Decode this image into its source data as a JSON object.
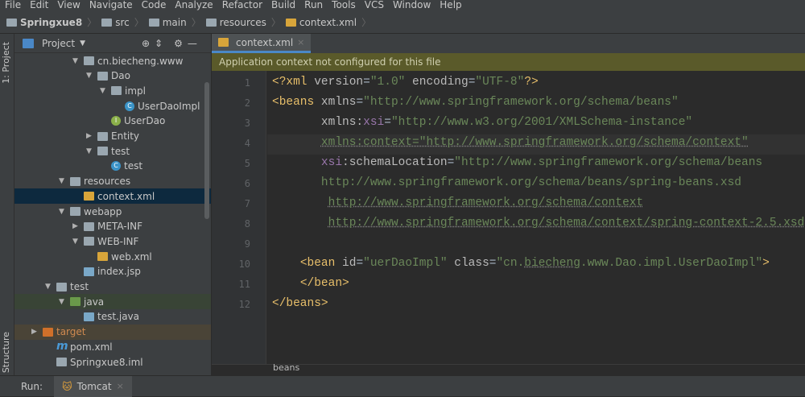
{
  "menu": [
    "File",
    "Edit",
    "View",
    "Navigate",
    "Code",
    "Analyze",
    "Refactor",
    "Build",
    "Run",
    "Tools",
    "VCS",
    "Window",
    "Help"
  ],
  "breadcrumb": [
    "Springxue8",
    "src",
    "main",
    "resources",
    "context.xml"
  ],
  "side_tabs": {
    "project": "1: Project",
    "structure": "Structure"
  },
  "panel": {
    "title": "Project"
  },
  "tree": [
    {
      "label": "cn.biecheng.www",
      "icon": "package",
      "arrow": "▼",
      "level": 4
    },
    {
      "label": "Dao",
      "icon": "folder",
      "arrow": "▼",
      "level": 5
    },
    {
      "label": "impl",
      "icon": "folder",
      "arrow": "▼",
      "level": 6
    },
    {
      "label": "UserDaoImpl",
      "icon": "class",
      "arrow": "",
      "level": 7
    },
    {
      "label": "UserDao",
      "icon": "interface",
      "arrow": "",
      "level": 6
    },
    {
      "label": "Entity",
      "icon": "folder",
      "arrow": "▶",
      "level": 5
    },
    {
      "label": "test",
      "icon": "folder",
      "arrow": "▼",
      "level": 5
    },
    {
      "label": "test",
      "icon": "class",
      "arrow": "",
      "level": 6
    },
    {
      "label": "resources",
      "icon": "folder",
      "arrow": "▼",
      "level": 3
    },
    {
      "label": "context.xml",
      "icon": "xml",
      "arrow": "",
      "level": 4,
      "selected": true
    },
    {
      "label": "webapp",
      "icon": "folder",
      "arrow": "▼",
      "level": 3
    },
    {
      "label": "META-INF",
      "icon": "folder",
      "arrow": "▶",
      "level": 4
    },
    {
      "label": "WEB-INF",
      "icon": "folder",
      "arrow": "▼",
      "level": 4
    },
    {
      "label": "web.xml",
      "icon": "xml",
      "arrow": "",
      "level": 5
    },
    {
      "label": "index.jsp",
      "icon": "jsp",
      "arrow": "",
      "level": 4
    },
    {
      "label": "test",
      "icon": "folder",
      "arrow": "▼",
      "level": 2
    },
    {
      "label": "java",
      "icon": "folder-green",
      "arrow": "▼",
      "level": 3,
      "highlight": "green"
    },
    {
      "label": "test.java",
      "icon": "jsp",
      "arrow": "",
      "level": 4
    },
    {
      "label": "target",
      "icon": "folder-orange",
      "arrow": "▶",
      "level": 1,
      "highlight": "brown"
    },
    {
      "label": "pom.xml",
      "icon": "maven",
      "arrow": "",
      "level": 2
    },
    {
      "label": "Springxue8.iml",
      "icon": "iml",
      "arrow": "",
      "level": 2
    }
  ],
  "editor": {
    "tab": "context.xml",
    "notice": "Application context not configured for this file",
    "lines": [
      [
        [
          "tag",
          "<?xml "
        ],
        [
          "att",
          "version"
        ],
        [
          "",
          "="
        ],
        [
          "str",
          "\"1.0\""
        ],
        [
          "att",
          " encoding"
        ],
        [
          "",
          "="
        ],
        [
          "str",
          "\"UTF-8\""
        ],
        [
          "tag",
          "?>"
        ]
      ],
      [
        [
          "tag",
          "<beans "
        ],
        [
          "att",
          "xmlns"
        ],
        [
          "",
          "="
        ],
        [
          "str",
          "\"http://www.springframework.org/schema/beans\""
        ]
      ],
      [
        [
          "",
          "       "
        ],
        [
          "att",
          "xmlns:"
        ],
        [
          "ns",
          "xsi"
        ],
        [
          "",
          "="
        ],
        [
          "str",
          "\"http://www.w3.org/2001/XMLSchema-instance\""
        ]
      ],
      [
        [
          "",
          "       "
        ],
        [
          "url",
          "xmlns:context=\"http://www.springframework.org/schema/context\""
        ]
      ],
      [
        [
          "",
          "       "
        ],
        [
          "ns",
          "xsi"
        ],
        [
          "att",
          ":schemaLocation"
        ],
        [
          "",
          "="
        ],
        [
          "str",
          "\"http://www.springframework.org/schema/beans"
        ]
      ],
      [
        [
          "",
          "       "
        ],
        [
          "str",
          "http://www.springframework.org/schema/beans/spring-beans.xsd"
        ]
      ],
      [
        [
          "",
          "        "
        ],
        [
          "url",
          "http://www.springframework.org/schema/context"
        ]
      ],
      [
        [
          "",
          "        "
        ],
        [
          "url",
          "http://www.springframework.org/schema/context/spring-context-2.5.xsd"
        ],
        [
          "str",
          "\">"
        ]
      ],
      [],
      [
        [
          "",
          "    "
        ],
        [
          "tag",
          "<bean "
        ],
        [
          "att",
          "id"
        ],
        [
          "",
          "="
        ],
        [
          "str",
          "\"uerDaoImpl\""
        ],
        [
          "att",
          " class"
        ],
        [
          "",
          "="
        ],
        [
          "str",
          "\"cn."
        ],
        [
          "url",
          "biecheng"
        ],
        [
          "str",
          ".www.Dao.impl.UserDaoImpl\""
        ],
        [
          "tag",
          ">"
        ]
      ],
      [
        [
          "",
          "    "
        ],
        [
          "tag",
          "</bean>"
        ]
      ],
      [
        [
          "tag",
          "</beans>"
        ]
      ]
    ],
    "status": "beans"
  },
  "run": {
    "label": "Run:",
    "tab": "Tomcat"
  }
}
